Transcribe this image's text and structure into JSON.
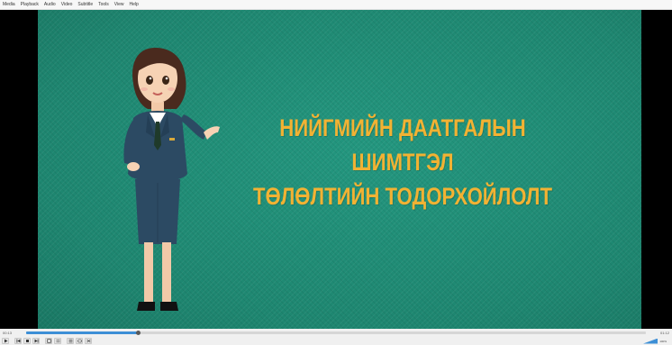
{
  "menu": {
    "items": [
      "Media",
      "Playback",
      "Audio",
      "Video",
      "Subtitle",
      "Tools",
      "View",
      "Help"
    ]
  },
  "video": {
    "title_line1": "НИЙГМИЙН ДААТГАЛЫН ШИМТГЭЛ",
    "title_line2": "ТӨЛӨЛТИЙН ТОДОРХОЙЛОЛТ",
    "title_color": "#f2b233",
    "background_color": "#1f8a74"
  },
  "playback": {
    "elapsed": "00:13",
    "total": "01:12",
    "progress_fraction": 0.18,
    "volume_label": "100%",
    "accent": "#3d8fd6"
  },
  "controls": {
    "buttons": [
      "play-icon",
      "previous-icon",
      "stop-icon",
      "next-icon",
      "fullscreen-icon",
      "extended-settings-icon",
      "playlist-icon",
      "loop-icon",
      "random-icon"
    ]
  }
}
